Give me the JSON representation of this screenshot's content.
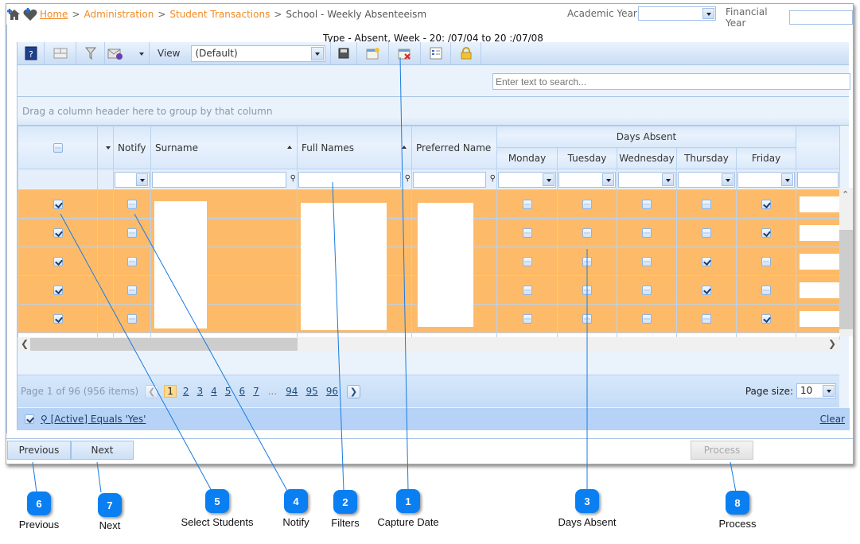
{
  "breadcrumb": {
    "icons": [
      "add-home-icon",
      "add-favourite-icon"
    ],
    "items": [
      {
        "label": "Home",
        "link": true
      },
      {
        "label": "Administration",
        "link": true
      },
      {
        "label": "Student Transactions",
        "link": true
      },
      {
        "label": "School - Weekly Absenteeism",
        "link": false
      }
    ],
    "separator": ">"
  },
  "header": {
    "academic_year_label": "Academic Year",
    "academic_year_value": "",
    "financial_year_label": "Financial Year",
    "financial_year_value": ""
  },
  "type_line": "Type - Absent, Week - 20:  /07/04 to 20  :/07/08",
  "toolbar": {
    "buttons": [
      "help-icon",
      "column-chooser-icon",
      "filter-icon",
      "email-icon",
      "dropdown-icon"
    ],
    "view_label": "View",
    "view_value": "(Default)",
    "right_buttons": [
      "save-icon",
      "capture-date-icon",
      "delete-view-icon",
      "layout-icon",
      "lock-icon"
    ]
  },
  "search": {
    "placeholder": "Enter text to search..."
  },
  "group_hint": "Drag a column header here to group by that column",
  "columns": {
    "select": "",
    "notify": "Notify",
    "surname": "Surname",
    "full_names": "Full Names",
    "preferred_name": "Preferred Name",
    "days_absent": "Days Absent",
    "days": [
      "Monday",
      "Tuesday",
      "Wednesday",
      "Thursday",
      "Friday"
    ]
  },
  "rows": [
    {
      "selected": true,
      "notify": false,
      "days": [
        false,
        false,
        false,
        false,
        true
      ]
    },
    {
      "selected": true,
      "notify": false,
      "days": [
        false,
        false,
        false,
        false,
        true
      ]
    },
    {
      "selected": true,
      "notify": false,
      "days": [
        false,
        false,
        false,
        true,
        false
      ]
    },
    {
      "selected": true,
      "notify": false,
      "days": [
        false,
        false,
        false,
        true,
        false
      ]
    },
    {
      "selected": true,
      "notify": false,
      "days": [
        false,
        false,
        false,
        false,
        true
      ]
    }
  ],
  "colors": {
    "row_highlight": "#fdbb6a",
    "accent": "#0a7ff2",
    "link_orange": "#f08a24"
  },
  "pager": {
    "info": "Page 1 of 96 (956 items)",
    "pages": [
      "1",
      "2",
      "3",
      "4",
      "5",
      "6",
      "7"
    ],
    "ellipsis": "...",
    "last_pages": [
      "94",
      "95",
      "96"
    ],
    "current": "1",
    "page_size_label": "Page size:",
    "page_size_value": "10"
  },
  "filter_bar": {
    "enabled": true,
    "expression": "[Active] Equals 'Yes'",
    "clear_label": "Clear"
  },
  "footer": {
    "previous_label": "Previous",
    "next_label": "Next",
    "process_label": "Process"
  },
  "callouts": [
    {
      "num": "1",
      "label": "Capture Date"
    },
    {
      "num": "2",
      "label": "Filters"
    },
    {
      "num": "3",
      "label": "Days Absent"
    },
    {
      "num": "4",
      "label": "Notify"
    },
    {
      "num": "5",
      "label": "Select Students"
    },
    {
      "num": "6",
      "label": "Previous"
    },
    {
      "num": "7",
      "label": "Next"
    },
    {
      "num": "8",
      "label": "Process"
    }
  ]
}
